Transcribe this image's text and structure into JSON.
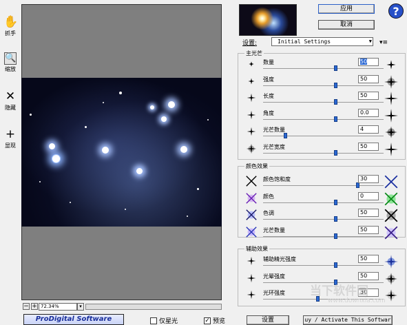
{
  "toolbar": {
    "grab": {
      "label": "抓手",
      "icon": "hand-icon"
    },
    "zoom": {
      "label": "缩放",
      "icon": "magnifier-icon"
    },
    "hide": {
      "label": "隐藏",
      "icon": "x-icon"
    },
    "show": {
      "label": "显现",
      "icon": "plus-icon"
    }
  },
  "canvas": {
    "zoom_value": "72.34%"
  },
  "bottom": {
    "brand": "ProDigital Software",
    "only_starlight": "仅星光",
    "preview_check": "预览",
    "settings_button": "设置",
    "buy_button": "uy / Activate This Softwar"
  },
  "header": {
    "apply_button": "应用",
    "cancel_button": "取消",
    "help": "?"
  },
  "settings": {
    "label": "设置:",
    "preset": "Initial Settings"
  },
  "groups": {
    "main": {
      "title": "主光芒",
      "rows": [
        {
          "label": "数量",
          "value": "50",
          "slider": 0.6,
          "highlight": true
        },
        {
          "label": "强度",
          "value": "50",
          "slider": 0.6
        },
        {
          "label": "长度",
          "value": "50",
          "slider": 0.6
        },
        {
          "label": "角度",
          "value": "0.0",
          "slider": 0.6
        },
        {
          "label": "光芒数量",
          "value": "4",
          "slider": 0.18
        },
        {
          "label": "光芒宽度",
          "value": "50",
          "slider": 0.6
        }
      ]
    },
    "color": {
      "title": "颜色效果",
      "rows": [
        {
          "label": "颜色饱和度",
          "value": "30",
          "slider": 0.78
        },
        {
          "label": "颜色",
          "value": "0",
          "slider": 0.6
        },
        {
          "label": "色调",
          "value": "50",
          "slider": 0.6
        },
        {
          "label": "光芒数量",
          "value": "50",
          "slider": 0.6
        }
      ]
    },
    "aux": {
      "title": "辅助效果",
      "rows": [
        {
          "label": "辅助精光强度",
          "value": "50",
          "slider": 0.6
        },
        {
          "label": "光晕强度",
          "value": "50",
          "slider": 0.6
        },
        {
          "label": "光环强度",
          "value": "30",
          "slider": 0.45
        }
      ]
    }
  },
  "watermark": {
    "text": "当下软件园",
    "url": "www.downxia.com"
  }
}
